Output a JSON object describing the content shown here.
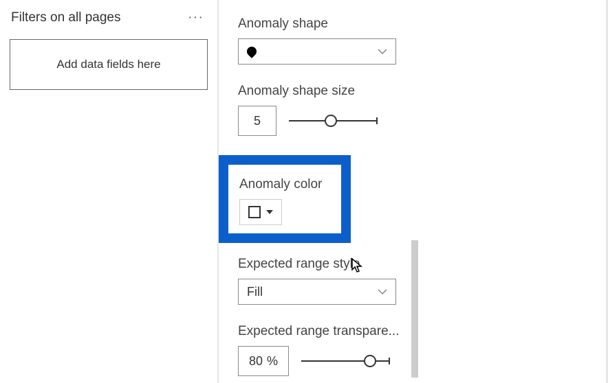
{
  "filters": {
    "title": "Filters on all pages",
    "placeholder": "Add data fields here"
  },
  "format": {
    "anomalyShape": {
      "label": "Anomaly shape"
    },
    "anomalyShapeSize": {
      "label": "Anomaly shape size",
      "value": "5",
      "sliderPercent": 48
    },
    "anomalyColor": {
      "label": "Anomaly color",
      "value": "#FFFFFF"
    },
    "expectedRangeStyle": {
      "label": "Expected range style",
      "value": "Fill"
    },
    "expectedRangeTransparency": {
      "label": "Expected range transpare...",
      "value": "80",
      "unit": "%",
      "sliderPercent": 78
    }
  }
}
